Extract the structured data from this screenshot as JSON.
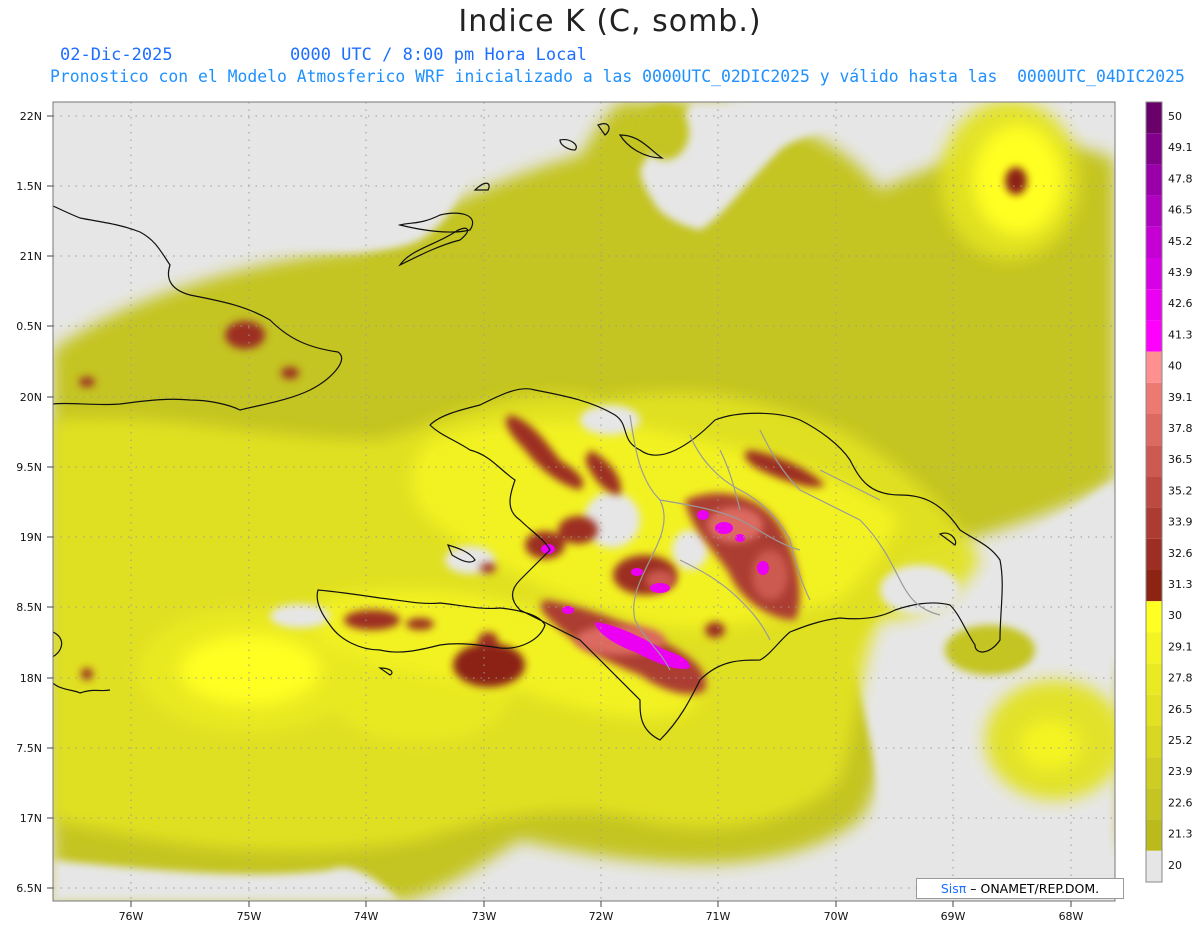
{
  "header": {
    "title": "Indice K (C, somb.)",
    "date": "02-Dic-2025",
    "time": "0000 UTC / 8:00 pm Hora Local",
    "model_line": "Pronostico con el Modelo Atmosferico WRF inicializado a las 0000UTC_02DIC2025 y válido hasta las  0000UTC_04DIC2025",
    "accent_color": "#1e90ff"
  },
  "map": {
    "lat_labels": [
      "22N",
      "1.5N",
      "21N",
      "0.5N",
      "20N",
      "9.5N",
      "19N",
      "8.5N",
      "18N",
      "7.5N",
      "17N",
      "6.5N"
    ],
    "lon_labels": [
      "76W",
      "75W",
      "74W",
      "73W",
      "72W",
      "71W",
      "70W",
      "69W",
      "68W"
    ]
  },
  "colorbar": {
    "labels": [
      "50",
      "49.1",
      "47.8",
      "46.5",
      "45.2",
      "43.9",
      "42.6",
      "41.3",
      "40",
      "39.1",
      "37.8",
      "36.5",
      "35.2",
      "33.9",
      "32.6",
      "31.3",
      "30",
      "29.1",
      "27.8",
      "26.5",
      "25.2",
      "23.9",
      "22.6",
      "21.3",
      "20"
    ],
    "colors": [
      "#6a006a",
      "#80008a",
      "#9900aa",
      "#b000c0",
      "#c400d4",
      "#d800e6",
      "#ec00f4",
      "#ff00ff",
      "#ff9090",
      "#ec7a70",
      "#dc6a60",
      "#cc5a50",
      "#bc4a40",
      "#ac3c32",
      "#9c2e24",
      "#8c2414",
      "#ffff22",
      "#f4f422",
      "#eaea22",
      "#e2e222",
      "#d8d822",
      "#cece22",
      "#c4c422",
      "#baba1a",
      "#e6e6e6"
    ]
  },
  "credit": {
    "brand": "Sisπ",
    "rest": " – ONAMET/REP.DOM."
  }
}
